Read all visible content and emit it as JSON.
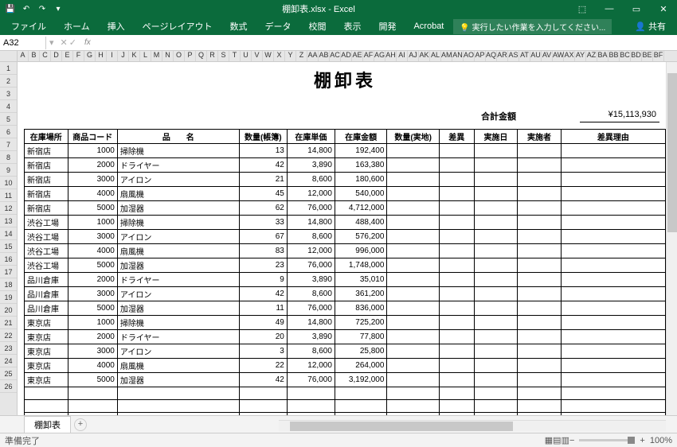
{
  "title": "棚卸表.xlsx - Excel",
  "qat": {
    "save": "💾",
    "undo": "↶",
    "redo": "↷"
  },
  "win": {
    "min": "—",
    "max": "▭",
    "close": "✕",
    "opts": "⚙"
  },
  "ribbon": {
    "tabs": [
      "ファイル",
      "ホーム",
      "挿入",
      "ページレイアウト",
      "数式",
      "データ",
      "校閲",
      "表示",
      "開発",
      "Acrobat"
    ],
    "tell": "💡 実行したい作業を入力してください...",
    "share": "共有"
  },
  "namebox": {
    "ref": "A32",
    "fx": "fx"
  },
  "cols": [
    "A",
    "B",
    "C",
    "D",
    "E",
    "F",
    "G",
    "H",
    "I",
    "J",
    "K",
    "L",
    "M",
    "N",
    "O",
    "P",
    "Q",
    "R",
    "S",
    "T",
    "U",
    "V",
    "W",
    "X",
    "Y",
    "Z",
    "AA",
    "AB",
    "AC",
    "AD",
    "AE",
    "AF",
    "AG",
    "AH",
    "AI",
    "AJ",
    "AK",
    "AL",
    "AM",
    "AN",
    "AO",
    "AP",
    "AQ",
    "AR",
    "AS",
    "AT",
    "AU",
    "AV",
    "AW",
    "AX",
    "AY",
    "AZ",
    "BA",
    "BB",
    "BC",
    "BD",
    "BE",
    "BF"
  ],
  "rows": [
    "1",
    "2",
    "3",
    "4",
    "5",
    "6",
    "7",
    "8",
    "9",
    "10",
    "11",
    "12",
    "13",
    "14",
    "15",
    "16",
    "17",
    "18",
    "19",
    "20",
    "21",
    "22",
    "23",
    "24",
    "25",
    "26"
  ],
  "doc": {
    "title": "棚卸表",
    "total_label": "合計金額",
    "total_value": "¥15,113,930",
    "headers": [
      "在庫場所",
      "商品コード",
      "品　　名",
      "数量(帳簿)",
      "在庫単価",
      "在庫金額",
      "数量(実地)",
      "差異",
      "実施日",
      "実施者",
      "差異理由"
    ],
    "rows": [
      [
        "新宿店",
        "1000",
        "掃除機",
        "13",
        "14,800",
        "192,400",
        "",
        "",
        "",
        "",
        ""
      ],
      [
        "新宿店",
        "2000",
        "ドライヤー",
        "42",
        "3,890",
        "163,380",
        "",
        "",
        "",
        "",
        ""
      ],
      [
        "新宿店",
        "3000",
        "アイロン",
        "21",
        "8,600",
        "180,600",
        "",
        "",
        "",
        "",
        ""
      ],
      [
        "新宿店",
        "4000",
        "扇風機",
        "45",
        "12,000",
        "540,000",
        "",
        "",
        "",
        "",
        ""
      ],
      [
        "新宿店",
        "5000",
        "加湿器",
        "62",
        "76,000",
        "4,712,000",
        "",
        "",
        "",
        "",
        ""
      ],
      [
        "渋谷工場",
        "1000",
        "掃除機",
        "33",
        "14,800",
        "488,400",
        "",
        "",
        "",
        "",
        ""
      ],
      [
        "渋谷工場",
        "3000",
        "アイロン",
        "67",
        "8,600",
        "576,200",
        "",
        "",
        "",
        "",
        ""
      ],
      [
        "渋谷工場",
        "4000",
        "扇風機",
        "83",
        "12,000",
        "996,000",
        "",
        "",
        "",
        "",
        ""
      ],
      [
        "渋谷工場",
        "5000",
        "加湿器",
        "23",
        "76,000",
        "1,748,000",
        "",
        "",
        "",
        "",
        ""
      ],
      [
        "品川倉庫",
        "2000",
        "ドライヤー",
        "9",
        "3,890",
        "35,010",
        "",
        "",
        "",
        "",
        ""
      ],
      [
        "品川倉庫",
        "3000",
        "アイロン",
        "42",
        "8,600",
        "361,200",
        "",
        "",
        "",
        "",
        ""
      ],
      [
        "品川倉庫",
        "5000",
        "加湿器",
        "11",
        "76,000",
        "836,000",
        "",
        "",
        "",
        "",
        ""
      ],
      [
        "東京店",
        "1000",
        "掃除機",
        "49",
        "14,800",
        "725,200",
        "",
        "",
        "",
        "",
        ""
      ],
      [
        "東京店",
        "2000",
        "ドライヤー",
        "20",
        "3,890",
        "77,800",
        "",
        "",
        "",
        "",
        ""
      ],
      [
        "東京店",
        "3000",
        "アイロン",
        "3",
        "8,600",
        "25,800",
        "",
        "",
        "",
        "",
        ""
      ],
      [
        "東京店",
        "4000",
        "扇風機",
        "22",
        "12,000",
        "264,000",
        "",
        "",
        "",
        "",
        ""
      ],
      [
        "東京店",
        "5000",
        "加湿器",
        "42",
        "76,000",
        "3,192,000",
        "",
        "",
        "",
        "",
        ""
      ]
    ]
  },
  "sheettab": "棚卸表",
  "status": {
    "ready": "準備完了",
    "zoom": "100%",
    "plus": "+",
    "minus": "−"
  }
}
